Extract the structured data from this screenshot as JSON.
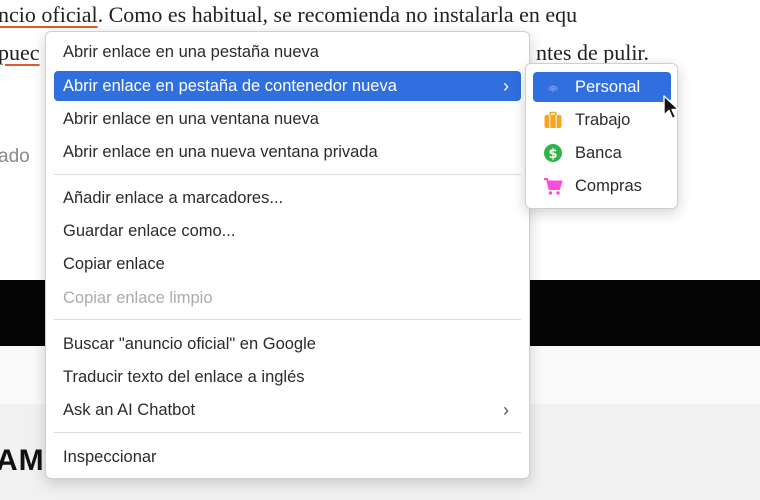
{
  "article": {
    "line1_link": "ncio oficial",
    "line1_rest": ". Como es habitual, se recomienda no instalarla en equ",
    "line2_start": "puec",
    "line2_end": "ntes de pulir.",
    "side_text": "ado"
  },
  "bottom_heading": "AM",
  "context_menu": {
    "items": [
      {
        "label": "Abrir enlace en una pestaña nueva"
      },
      {
        "label": "Abrir enlace en pestaña de contenedor nueva",
        "chevron": "›"
      },
      {
        "label": "Abrir enlace en una ventana nueva"
      },
      {
        "label": "Abrir enlace en una nueva ventana privada"
      },
      {
        "label": "Añadir enlace a marcadores..."
      },
      {
        "label": "Guardar enlace como..."
      },
      {
        "label": "Copiar enlace"
      },
      {
        "label": "Copiar enlace limpio"
      },
      {
        "label": "Buscar \"anuncio oficial\" en Google"
      },
      {
        "label": "Traducir texto del enlace a inglés"
      },
      {
        "label": "Ask an AI Chatbot",
        "chevron": "›"
      },
      {
        "label": "Inspeccionar"
      }
    ]
  },
  "container_submenu": {
    "items": [
      {
        "label": "Personal",
        "icon": "fingerprint-icon",
        "color": "#2f6fde"
      },
      {
        "label": "Trabajo",
        "icon": "briefcase-icon",
        "color": "#f5a623"
      },
      {
        "label": "Banca",
        "icon": "dollar-icon",
        "color": "#30b34a"
      },
      {
        "label": "Compras",
        "icon": "cart-icon",
        "color": "#ff4bda"
      }
    ]
  },
  "colors": {
    "accent": "#2f6fde",
    "link_underline": "#e05b2c",
    "disabled_text": "#ababab"
  }
}
